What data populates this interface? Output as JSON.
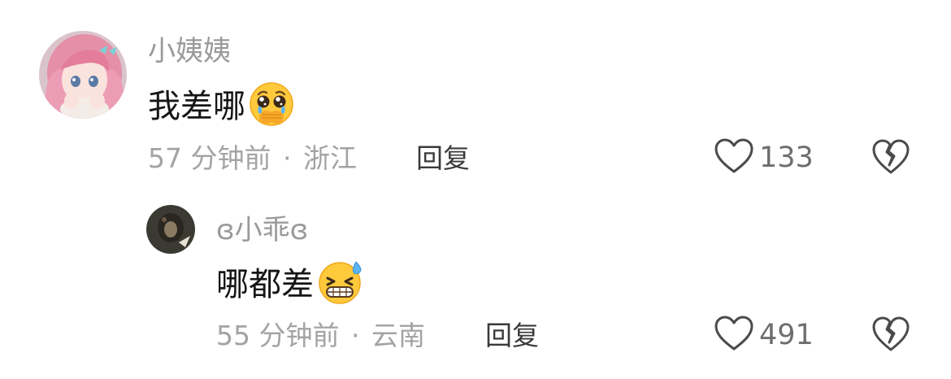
{
  "comments": [
    {
      "username": "小姨姨",
      "text": "我差哪",
      "emoji": "pleading-face-emoji",
      "time": "57 分钟前",
      "location": "浙江",
      "reply_label": "回复",
      "likes": "133"
    },
    {
      "username": "ɞ小乖ɞ",
      "text": "哪都差",
      "emoji": "grinning-sweat-emoji",
      "time": "55 分钟前",
      "location": "云南",
      "reply_label": "回复",
      "likes": "491"
    }
  ],
  "separator": "·",
  "icons": {
    "like": "heart-outline-icon",
    "dislike": "broken-heart-outline-icon"
  },
  "colors": {
    "username": "#9a9a9a",
    "content": "#161616",
    "meta": "#a3a3a3",
    "reply": "#3a3a3a",
    "likes": "#6e6e6e",
    "icon_stroke": "#4a4a4a",
    "avatar1_bg": "#e58fa8",
    "emoji_yellow": "#ffc93c"
  }
}
